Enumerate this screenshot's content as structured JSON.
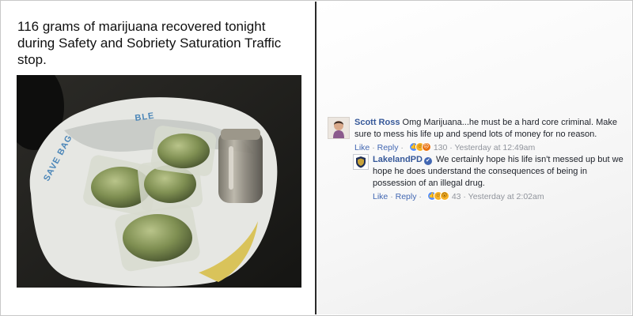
{
  "post": {
    "text": "116 grams of marijuana recovered tonight\nduring Safety and Sobriety Saturation Traffic\nstop."
  },
  "photo": {
    "bag_print": "SAVE BAG",
    "bag_print_2": "BLE"
  },
  "comments": [
    {
      "author": "Scott Ross",
      "text": "Omg Marijuana...he must be a hard core criminal. Make sure to mess his life up and spend lots of money for no reason.",
      "like": "Like",
      "reply": "Reply",
      "reactions_count": "130",
      "timestamp": "Yesterday at 12:49am"
    },
    {
      "author": "LakelandPD",
      "verified": "✔",
      "text": "We certainly hope his life isn't messed up but we hope he does understand the consequences of being in possession of an illegal drug.",
      "like": "Like",
      "reply": "Reply",
      "reactions_count": "43",
      "timestamp": "Yesterday at 2:02am"
    }
  ],
  "separators": {
    "dot": "·"
  },
  "colors": {
    "link_blue": "#365899",
    "meta_gray": "#90949c",
    "like_blue": "#5890ff",
    "divider": "#2a2a2a"
  }
}
